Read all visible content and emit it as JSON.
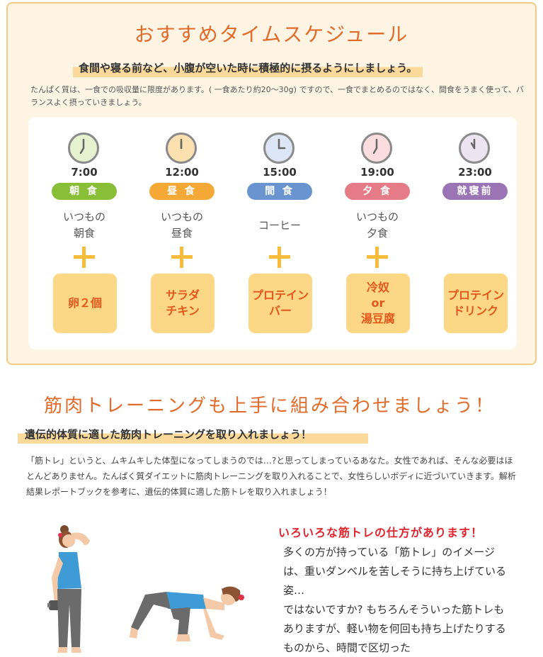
{
  "schedule": {
    "title": "おすすめタイムスケジュール",
    "subtitle": "食間や寝る前など、小腹が空いた時に積極的に摂るようにしましょう。",
    "description": "たんぱく質は、一食での吸収量に限度があります。( 一食あたり約20～30g) ですので、一食でまとめるのではなく、間食をうまく使って、バランスよく摂っていきましょう。",
    "columns": [
      {
        "time": "7:00",
        "meal": "朝 食",
        "usual": "いつもの\n朝食",
        "food": "卵２個",
        "color": "#88bf36",
        "clock_fill": "#e5f1cf",
        "hour_angle": 210,
        "minute_angle": 0
      },
      {
        "time": "12:00",
        "meal": "昼 食",
        "usual": "いつもの\n昼食",
        "food": "サラダ\nチキン",
        "color": "#f4a835",
        "clock_fill": "#fce1b0",
        "hour_angle": 0,
        "minute_angle": 0
      },
      {
        "time": "15:00",
        "meal": "間 食",
        "usual": "コーヒー",
        "food": "プロテイン\nバー",
        "color": "#6a94cf",
        "clock_fill": "#dde6f6",
        "hour_angle": 90,
        "minute_angle": 0
      },
      {
        "time": "19:00",
        "meal": "夕 食",
        "usual": "いつもの\n夕食",
        "food": "冷奴\nor\n湯豆腐",
        "color": "#e57b86",
        "clock_fill": "#fbdde0",
        "hour_angle": 210,
        "minute_angle": 0
      },
      {
        "time": "23:00",
        "meal": "就寝前",
        "usual": "",
        "food": "プロテイン\nドリンク",
        "color": "#9b74b6",
        "clock_fill": "#ece4f1",
        "hour_angle": 330,
        "minute_angle": 0
      }
    ]
  },
  "training": {
    "title": "筋肉トレーニングも上手に組み合わせましょう！",
    "subtitle": "遺伝的体質に適した筋肉トレーニングを取り入れましょう！",
    "description": "「筋トレ」というと、ムキムキした体型になってしまうのでは…?と思ってしまっているあなた。女性であれば、そんな必要はほとんどありません。たんぱく質ダイエットに筋肉トレーニングを取り入れることで、女性らしいボディに近づいていきます。解析結果レポートブックを参考に、遺伝的体質に適した筋トレを取り入れましょう！",
    "ways_title": "いろいろな筋トレの仕方があります！",
    "ways_body": "多くの方が持っている「筋トレ」のイメージは、重いダンベルを苦しそうに持ち上げている姿…\nではないですか? もちろんそういった筋トレもありますが、軽い物を何回も持ち上げたりするものから、時間で区切った"
  },
  "colors": {
    "accent_orange": "#e16b2a",
    "highlight": "#fbd99a",
    "box_bg": "#fdf4e4",
    "box_border": "#f4ca86",
    "food_bg": "#fcd785",
    "plus": "#f6bc3a",
    "ways_red": "#e0242e"
  },
  "icons": [
    "clock-icon",
    "plus-icon",
    "woman-dumbbell-illustration",
    "woman-lunge-illustration"
  ]
}
